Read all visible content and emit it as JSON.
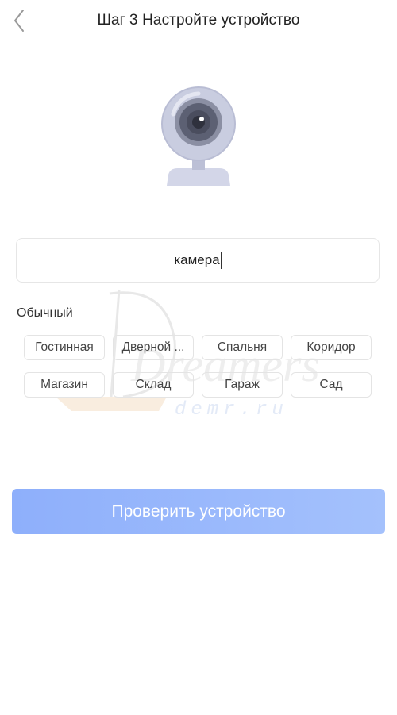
{
  "header": {
    "title": "Шаг 3 Настройте устройство",
    "back_icon": "chevron-left-icon"
  },
  "illustration": {
    "icon": "webcam-icon"
  },
  "name_field": {
    "value": "камера"
  },
  "section": {
    "label": "Обычный",
    "chips": [
      "Гостинная",
      "Дверной ...",
      "Спальня",
      "Коридор",
      "Магазин",
      "Склад",
      "Гараж",
      "Сад"
    ]
  },
  "watermark": {
    "title": "Dreamers",
    "subtitle": "demr.ru"
  },
  "button": {
    "label": "Проверить устройство"
  },
  "colors": {
    "button_gradient_start": "#8eaffb",
    "button_gradient_end": "#a4c1fc",
    "camera_body": "#c9cde0",
    "camera_lens": "#4a4d5e"
  }
}
